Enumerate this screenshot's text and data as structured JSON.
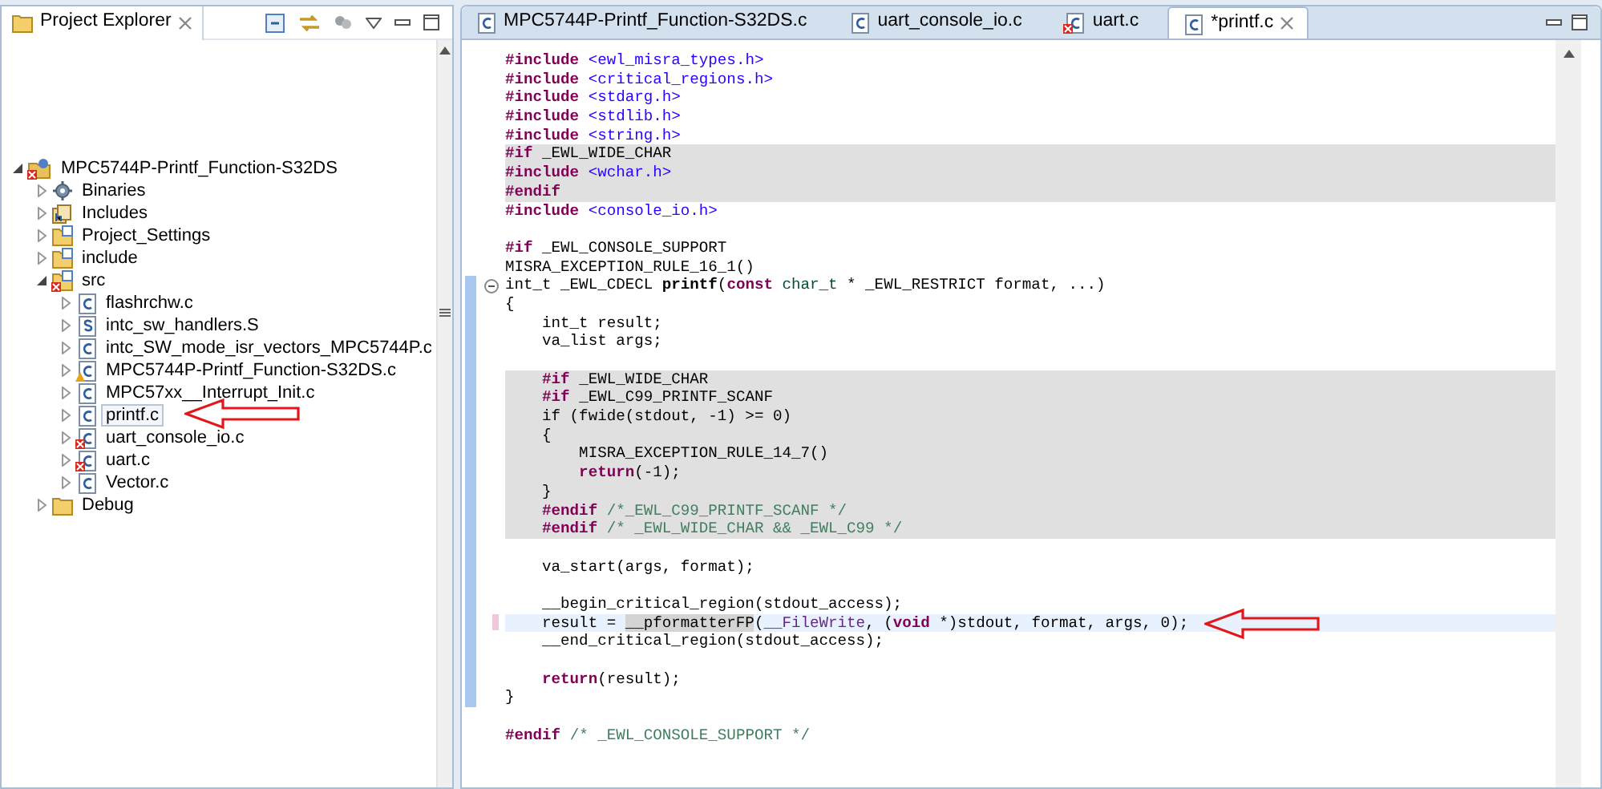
{
  "explorer": {
    "title": "Project Explorer",
    "tree": [
      {
        "label": "MPC5744P-Printf_Function-S32DS",
        "kind": "project",
        "error": true,
        "warning": false,
        "expanded": true,
        "selected": false,
        "arrow": false,
        "children": [
          {
            "label": "Binaries",
            "kind": "binaries",
            "error": false,
            "warning": false,
            "expanded": false,
            "selected": false,
            "arrow": false
          },
          {
            "label": "Includes",
            "kind": "includes",
            "error": false,
            "warning": false,
            "expanded": false,
            "selected": false,
            "arrow": false
          },
          {
            "label": "Project_Settings",
            "kind": "source-folder",
            "error": false,
            "warning": false,
            "expanded": false,
            "selected": false,
            "arrow": false
          },
          {
            "label": "include",
            "kind": "source-folder",
            "error": false,
            "warning": false,
            "expanded": false,
            "selected": false,
            "arrow": false
          },
          {
            "label": "src",
            "kind": "source-folder",
            "error": true,
            "warning": false,
            "expanded": true,
            "selected": false,
            "arrow": false,
            "children": [
              {
                "label": "flashrchw.c",
                "kind": "c-file",
                "error": false,
                "warning": false,
                "expanded": false,
                "selected": false,
                "arrow": false
              },
              {
                "label": "intc_sw_handlers.S",
                "kind": "asm-file",
                "error": false,
                "warning": false,
                "expanded": false,
                "selected": false,
                "arrow": false
              },
              {
                "label": "intc_SW_mode_isr_vectors_MPC5744P.c",
                "kind": "c-file",
                "error": false,
                "warning": false,
                "expanded": false,
                "selected": false,
                "arrow": false
              },
              {
                "label": "MPC5744P-Printf_Function-S32DS.c",
                "kind": "c-file",
                "error": false,
                "warning": true,
                "expanded": false,
                "selected": false,
                "arrow": false
              },
              {
                "label": "MPC57xx__Interrupt_Init.c",
                "kind": "c-file",
                "error": false,
                "warning": false,
                "expanded": false,
                "selected": false,
                "arrow": false
              },
              {
                "label": "printf.c",
                "kind": "c-file",
                "error": false,
                "warning": false,
                "expanded": false,
                "selected": true,
                "arrow": true
              },
              {
                "label": "uart_console_io.c",
                "kind": "c-file",
                "error": true,
                "warning": false,
                "expanded": false,
                "selected": false,
                "arrow": false
              },
              {
                "label": "uart.c",
                "kind": "c-file",
                "error": true,
                "warning": false,
                "expanded": false,
                "selected": false,
                "arrow": false
              },
              {
                "label": "Vector.c",
                "kind": "c-file",
                "error": false,
                "warning": false,
                "expanded": false,
                "selected": false,
                "arrow": false
              }
            ]
          },
          {
            "label": "Debug",
            "kind": "folder",
            "error": false,
            "warning": false,
            "expanded": false,
            "selected": false,
            "arrow": false
          }
        ]
      }
    ]
  },
  "editor": {
    "tabs": [
      {
        "label": "MPC5744P-Printf_Function-S32DS.c",
        "error": false,
        "selected": false
      },
      {
        "label": "uart_console_io.c",
        "error": false,
        "selected": false
      },
      {
        "label": "uart.c",
        "error": true,
        "selected": false
      },
      {
        "label": "*printf.c",
        "error": false,
        "selected": true
      }
    ],
    "lines": [
      {
        "segs": [
          {
            "kind": "directive",
            "text": "#include "
          },
          {
            "kind": "header",
            "text": "<ewl_misra_types.h>"
          }
        ],
        "inactive": false,
        "current": false,
        "range": false,
        "modified": false,
        "fold": false,
        "arrow": false
      },
      {
        "segs": [
          {
            "kind": "directive",
            "text": "#include "
          },
          {
            "kind": "header",
            "text": "<critical_regions.h>"
          }
        ],
        "inactive": false,
        "current": false,
        "range": false,
        "modified": false,
        "fold": false,
        "arrow": false
      },
      {
        "segs": [
          {
            "kind": "directive",
            "text": "#include "
          },
          {
            "kind": "header",
            "text": "<stdarg.h>"
          }
        ],
        "inactive": false,
        "current": false,
        "range": false,
        "modified": false,
        "fold": false,
        "arrow": false
      },
      {
        "segs": [
          {
            "kind": "directive",
            "text": "#include "
          },
          {
            "kind": "header",
            "text": "<stdlib.h>"
          }
        ],
        "inactive": false,
        "current": false,
        "range": false,
        "modified": false,
        "fold": false,
        "arrow": false
      },
      {
        "segs": [
          {
            "kind": "directive",
            "text": "#include "
          },
          {
            "kind": "header",
            "text": "<string.h>"
          }
        ],
        "inactive": false,
        "current": false,
        "range": false,
        "modified": false,
        "fold": false,
        "arrow": false
      },
      {
        "segs": [
          {
            "kind": "directive",
            "text": "#if"
          },
          {
            "kind": "text",
            "text": " _EWL_WIDE_CHAR"
          }
        ],
        "inactive": true,
        "current": false,
        "range": false,
        "modified": false,
        "fold": false,
        "arrow": false
      },
      {
        "segs": [
          {
            "kind": "directive",
            "text": "#include "
          },
          {
            "kind": "header",
            "text": "<wchar.h>"
          }
        ],
        "inactive": true,
        "current": false,
        "range": false,
        "modified": false,
        "fold": false,
        "arrow": false
      },
      {
        "segs": [
          {
            "kind": "directive",
            "text": "#endif"
          }
        ],
        "inactive": true,
        "current": false,
        "range": false,
        "modified": false,
        "fold": false,
        "arrow": false
      },
      {
        "segs": [
          {
            "kind": "directive",
            "text": "#include "
          },
          {
            "kind": "header",
            "text": "<console_io.h>"
          }
        ],
        "inactive": false,
        "current": false,
        "range": false,
        "modified": false,
        "fold": false,
        "arrow": false
      },
      {
        "inactive": false,
        "current": false,
        "range": false,
        "modified": false,
        "fold": false,
        "arrow": false
      },
      {
        "segs": [
          {
            "kind": "directive",
            "text": "#if"
          },
          {
            "kind": "text",
            "text": " _EWL_CONSOLE_SUPPORT"
          }
        ],
        "inactive": false,
        "current": false,
        "range": false,
        "modified": false,
        "fold": false,
        "arrow": false
      },
      {
        "segs": [
          {
            "kind": "text",
            "text": "MISRA_EXCEPTION_RULE_16_1()"
          }
        ],
        "inactive": false,
        "current": false,
        "range": false,
        "modified": false,
        "fold": false,
        "arrow": false
      },
      {
        "segs": [
          {
            "kind": "text",
            "text": "int_t _EWL_CDECL "
          },
          {
            "kind": "bold",
            "text": "printf"
          },
          {
            "kind": "text",
            "text": "("
          },
          {
            "kind": "keyword",
            "text": "const "
          },
          {
            "kind": "type",
            "text": "char_t"
          },
          {
            "kind": "text",
            "text": " * _EWL_RESTRICT format, ...)"
          }
        ],
        "inactive": false,
        "current": false,
        "range": true,
        "modified": false,
        "fold": true,
        "arrow": false
      },
      {
        "segs": [
          {
            "kind": "text",
            "text": "{"
          }
        ],
        "inactive": false,
        "current": false,
        "range": true,
        "modified": false,
        "fold": false,
        "arrow": false
      },
      {
        "segs": [
          {
            "kind": "text",
            "text": "    int_t result;"
          }
        ],
        "inactive": false,
        "current": false,
        "range": true,
        "modified": false,
        "fold": false,
        "arrow": false
      },
      {
        "segs": [
          {
            "kind": "text",
            "text": "    va_list args;"
          }
        ],
        "inactive": false,
        "current": false,
        "range": true,
        "modified": false,
        "fold": false,
        "arrow": false
      },
      {
        "inactive": false,
        "current": false,
        "range": true,
        "modified": false,
        "fold": false,
        "arrow": false
      },
      {
        "segs": [
          {
            "kind": "directive",
            "text": "    #if"
          },
          {
            "kind": "text",
            "text": " _EWL_WIDE_CHAR"
          }
        ],
        "inactive": true,
        "current": false,
        "range": true,
        "modified": false,
        "fold": false,
        "arrow": false
      },
      {
        "segs": [
          {
            "kind": "directive",
            "text": "    #if"
          },
          {
            "kind": "text",
            "text": " _EWL_C99_PRINTF_SCANF"
          }
        ],
        "inactive": true,
        "current": false,
        "range": true,
        "modified": false,
        "fold": false,
        "arrow": false
      },
      {
        "segs": [
          {
            "kind": "text",
            "text": "    if (fwide(stdout, -1) >= 0)"
          }
        ],
        "inactive": true,
        "current": false,
        "range": true,
        "modified": false,
        "fold": false,
        "arrow": false
      },
      {
        "segs": [
          {
            "kind": "text",
            "text": "    {"
          }
        ],
        "inactive": true,
        "current": false,
        "range": true,
        "modified": false,
        "fold": false,
        "arrow": false
      },
      {
        "segs": [
          {
            "kind": "text",
            "text": "        MISRA_EXCEPTION_RULE_14_7()"
          }
        ],
        "inactive": true,
        "current": false,
        "range": true,
        "modified": false,
        "fold": false,
        "arrow": false
      },
      {
        "segs": [
          {
            "kind": "keyword",
            "text": "        return"
          },
          {
            "kind": "text",
            "text": "(-1);"
          }
        ],
        "inactive": true,
        "current": false,
        "range": true,
        "modified": false,
        "fold": false,
        "arrow": false
      },
      {
        "segs": [
          {
            "kind": "text",
            "text": "    }"
          }
        ],
        "inactive": true,
        "current": false,
        "range": true,
        "modified": false,
        "fold": false,
        "arrow": false
      },
      {
        "segs": [
          {
            "kind": "directive",
            "text": "    #endif "
          },
          {
            "kind": "comment",
            "text": "/*_EWL_C99_PRINTF_SCANF */"
          }
        ],
        "inactive": true,
        "current": false,
        "range": true,
        "modified": false,
        "fold": false,
        "arrow": false
      },
      {
        "segs": [
          {
            "kind": "directive",
            "text": "    #endif "
          },
          {
            "kind": "comment",
            "text": "/* _EWL_WIDE_CHAR && _EWL_C99 */"
          }
        ],
        "inactive": true,
        "current": false,
        "range": true,
        "modified": false,
        "fold": false,
        "arrow": false
      },
      {
        "inactive": false,
        "current": false,
        "range": true,
        "modified": false,
        "fold": false,
        "arrow": false
      },
      {
        "segs": [
          {
            "kind": "text",
            "text": "    va_start(args, format);"
          }
        ],
        "inactive": false,
        "current": false,
        "range": true,
        "modified": false,
        "fold": false,
        "arrow": false
      },
      {
        "inactive": false,
        "current": false,
        "range": true,
        "modified": false,
        "fold": false,
        "arrow": false
      },
      {
        "segs": [
          {
            "kind": "text",
            "text": "    __begin_critical_region(stdout_access);"
          }
        ],
        "inactive": false,
        "current": false,
        "range": true,
        "modified": false,
        "fold": false,
        "arrow": false
      },
      {
        "segs": [
          {
            "kind": "text",
            "text": "    result = "
          },
          {
            "kind": "occurrence",
            "text": "__pformatterFP"
          },
          {
            "kind": "text",
            "text": "("
          },
          {
            "kind": "macro",
            "text": "__FileWrite"
          },
          {
            "kind": "text",
            "text": ", ("
          },
          {
            "kind": "keyword",
            "text": "void"
          },
          {
            "kind": "text",
            "text": " *)stdout, format, args, 0);"
          }
        ],
        "inactive": false,
        "current": true,
        "range": true,
        "modified": true,
        "fold": false,
        "arrow": true
      },
      {
        "segs": [
          {
            "kind": "text",
            "text": "    __end_critical_region(stdout_access);"
          }
        ],
        "inactive": false,
        "current": false,
        "range": true,
        "modified": false,
        "fold": false,
        "arrow": false
      },
      {
        "inactive": false,
        "current": false,
        "range": true,
        "modified": false,
        "fold": false,
        "arrow": false
      },
      {
        "segs": [
          {
            "kind": "keyword",
            "text": "    return"
          },
          {
            "kind": "text",
            "text": "(result);"
          }
        ],
        "inactive": false,
        "current": false,
        "range": true,
        "modified": false,
        "fold": false,
        "arrow": false
      },
      {
        "segs": [
          {
            "kind": "text",
            "text": "}"
          }
        ],
        "inactive": false,
        "current": false,
        "range": true,
        "modified": false,
        "fold": false,
        "arrow": false
      },
      {
        "inactive": false,
        "current": false,
        "range": false,
        "modified": false,
        "fold": false,
        "arrow": false
      },
      {
        "segs": [
          {
            "kind": "directive",
            "text": "#endif "
          },
          {
            "kind": "comment",
            "text": "/* _EWL_CONSOLE_SUPPORT */"
          }
        ],
        "inactive": false,
        "current": false,
        "range": false,
        "modified": false,
        "fold": false,
        "arrow": false
      }
    ]
  }
}
